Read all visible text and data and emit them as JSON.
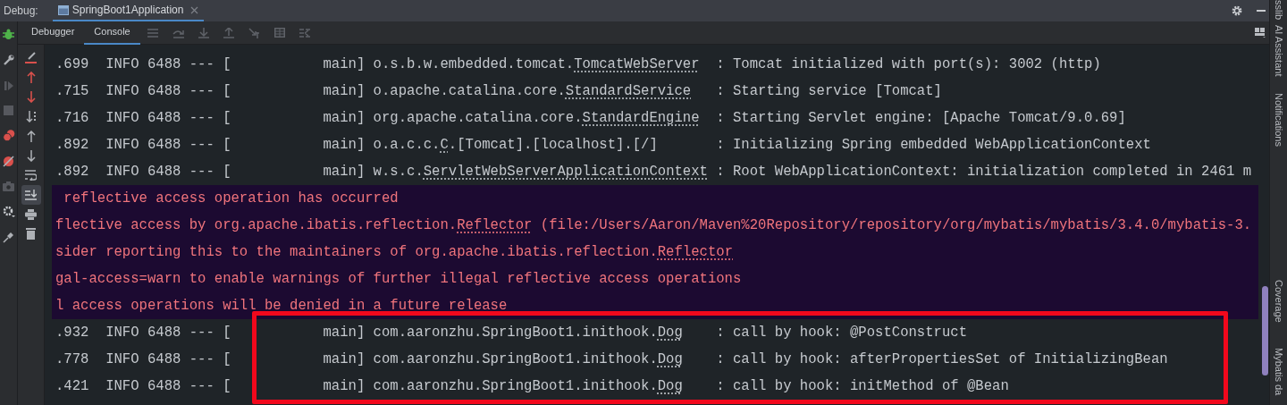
{
  "header": {
    "label": "Debug:",
    "session_tab": {
      "title": "SpringBoot1Application",
      "selected": true
    }
  },
  "toolbar_tabs": [
    {
      "label": "Debugger",
      "selected": false
    },
    {
      "label": "Console",
      "selected": true
    }
  ],
  "scroll_to_end_on": true,
  "console_lines": [
    {
      "kind": "info",
      "text": ".699  INFO 6488 --- [           main] o.s.b.w.embedded.tomcat.",
      "link": "TomcatWebServer",
      "after": "  : Tomcat initialized with port(s): 3002 (http)",
      "highlighted": false
    },
    {
      "kind": "info",
      "text": ".715  INFO 6488 --- [           main] o.apache.catalina.core.",
      "link": "StandardService",
      "after": "   : Starting service [Tomcat]",
      "highlighted": false
    },
    {
      "kind": "info",
      "text": ".716  INFO 6488 --- [           main] org.apache.catalina.core.",
      "link": "StandardEngine",
      "after": "  : Starting Servlet engine: [Apache Tomcat/9.0.69]",
      "highlighted": false
    },
    {
      "kind": "info",
      "text": ".892  INFO 6488 --- [           main] o.a.c.c.",
      "link": "C",
      "after": ".[Tomcat].[localhost].[/]       : Initializing Spring embedded WebApplicationContext",
      "highlighted": false
    },
    {
      "kind": "info",
      "text": ".892  INFO 6488 --- [           main] w.s.c.",
      "link": "ServletWebServerApplicationContext",
      "after": " : Root WebApplicationContext: initialization completed in 2461 m",
      "highlighted": false
    },
    {
      "kind": "warning",
      "text": " reflective access operation has occurred"
    },
    {
      "kind": "warning",
      "text": "flective access by org.apache.ibatis.reflection.",
      "link": "Reflector",
      "after": " (file:/Users/Aaron/Maven%20Repository/repository/org/mybatis/mybatis/3.4.0/mybatis-3."
    },
    {
      "kind": "warning",
      "text": "sider reporting this to the maintainers of org.apache.ibatis.reflection.",
      "link": "Reflector"
    },
    {
      "kind": "warning",
      "text": "gal-access=warn to enable warnings of further illegal reflective access operations"
    },
    {
      "kind": "warning",
      "text": "l access operations will be denied in a future release"
    },
    {
      "kind": "info",
      "text": ".932  INFO 6488 --- [           main] com.aaronzhu.SpringBoot1.inithook.",
      "link": "Dog",
      "after": "    : call by hook: @PostConstruct",
      "highlighted": true
    },
    {
      "kind": "info",
      "text": ".778  INFO 6488 --- [           main] com.aaronzhu.SpringBoot1.inithook.",
      "link": "Dog",
      "after": "    : call by hook: afterPropertiesSet of InitializingBean",
      "highlighted": true
    },
    {
      "kind": "info",
      "text": ".421  INFO 6488 --- [           main] com.aaronzhu.SpringBoot1.inithook.",
      "link": "Dog",
      "after": "    : call by hook: initMethod of @Bean",
      "highlighted": true
    }
  ],
  "right_stripe": [
    "sslib",
    "AI Assistant",
    "Notifications",
    "Coverage",
    "Mybatis da"
  ]
}
